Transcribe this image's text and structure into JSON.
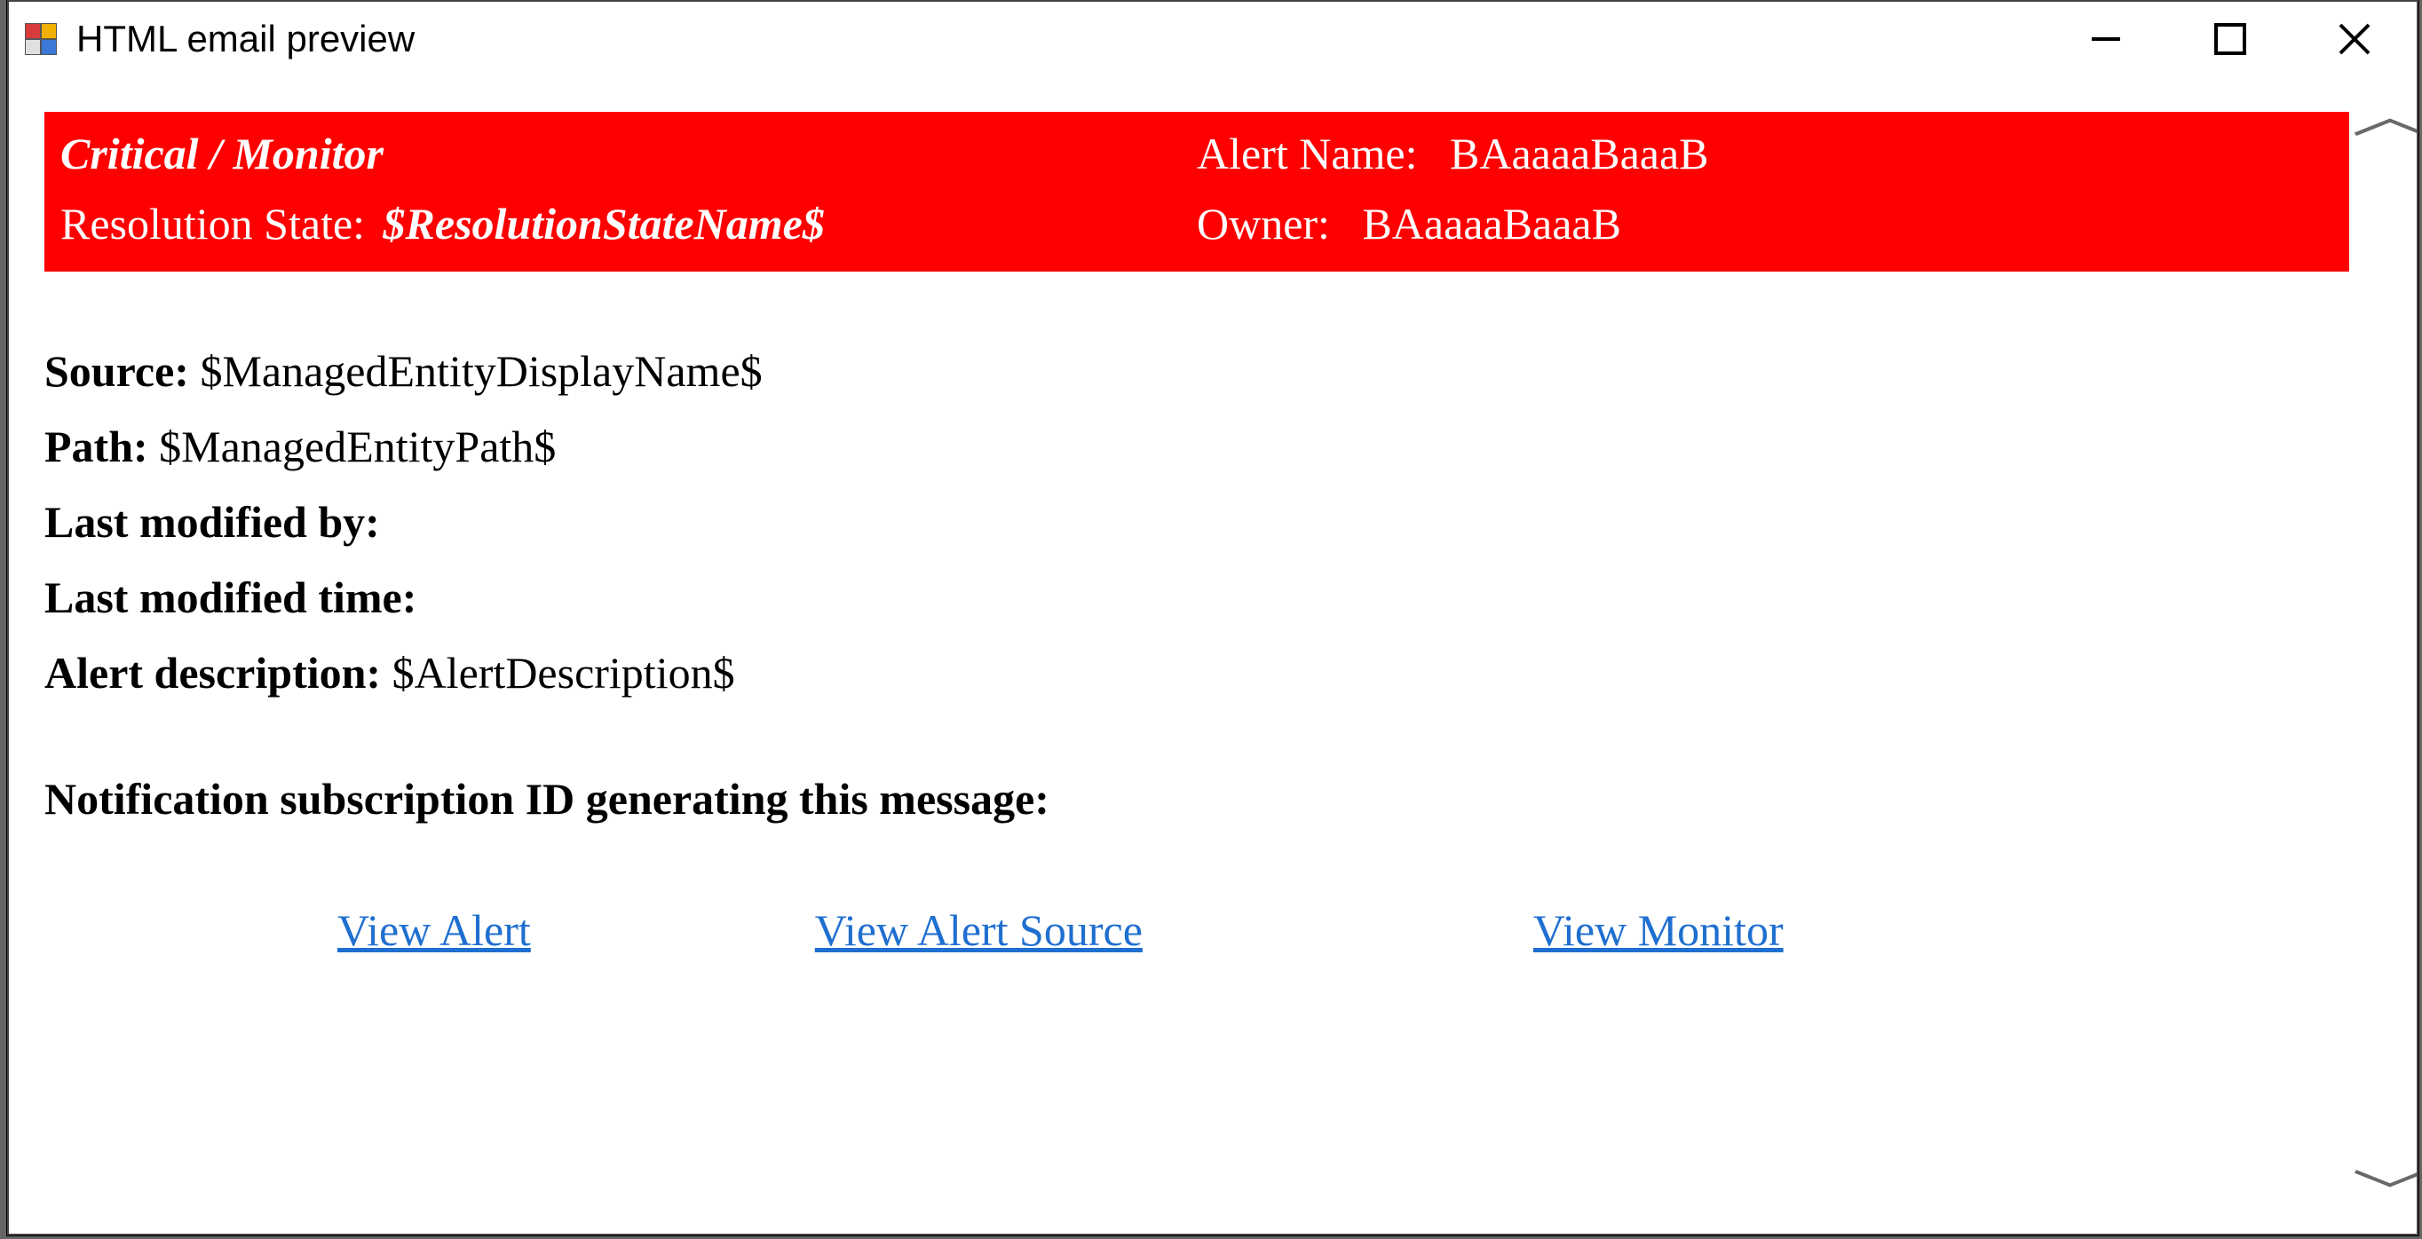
{
  "window": {
    "title": "HTML email preview"
  },
  "header": {
    "severity_source": "Critical / Monitor",
    "alert_name_label": "Alert Name:",
    "alert_name_value": "BAaaaaBaaaB",
    "resolution_state_label": "Resolution State:",
    "resolution_state_value": "$ResolutionStateName$",
    "owner_label": "Owner:",
    "owner_value": "BAaaaaBaaaB"
  },
  "details": {
    "source_label": "Source:",
    "source_value": "$ManagedEntityDisplayName$",
    "path_label": "Path:",
    "path_value": "$ManagedEntityPath$",
    "last_modified_by_label": "Last modified by:",
    "last_modified_by_value": "",
    "last_modified_time_label": "Last modified time:",
    "last_modified_time_value": "",
    "alert_description_label": "Alert description:",
    "alert_description_value": "$AlertDescription$"
  },
  "subscription": {
    "label": "Notification subscription ID generating this message:",
    "value": ""
  },
  "links": {
    "view_alert": "View Alert",
    "view_alert_source": "View Alert Source",
    "view_monitor": "View Monitor"
  },
  "colors": {
    "critical_bg": "#ff0000",
    "link": "#1f6fd0"
  }
}
